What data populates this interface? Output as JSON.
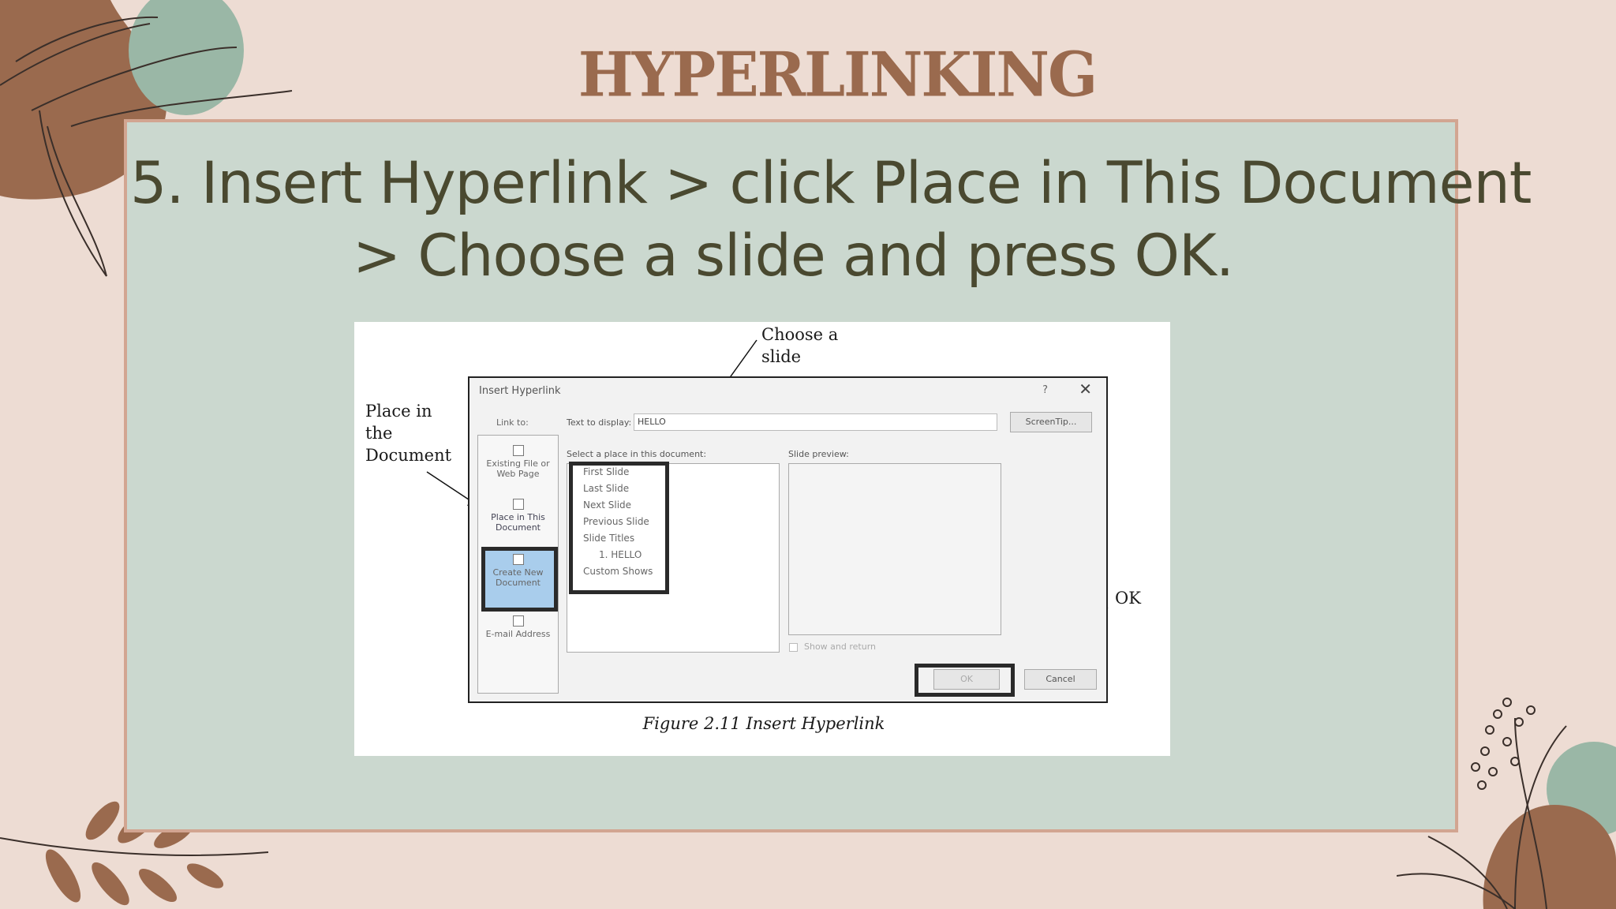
{
  "slide": {
    "title": "HYPERLINKING",
    "instruction_line1": "5. Insert Hyperlink > click Place in This Document",
    "instruction_line2": "> Choose a slide and press OK."
  },
  "figure": {
    "annot_place_line1": "Place in",
    "annot_place_line2": "the",
    "annot_place_line3": "Document",
    "annot_choose_line1": "Choose a",
    "annot_choose_line2": "slide",
    "annot_ok": "OK",
    "caption": "Figure 2.11 Insert Hyperlink"
  },
  "dialog": {
    "title": "Insert Hyperlink",
    "help": "?",
    "close": "✕",
    "link_to_label": "Link to:",
    "link_to_items": [
      {
        "line1": "Existing File or",
        "line2": "Web Page"
      },
      {
        "line1": "Place in This",
        "line2": "Document"
      },
      {
        "line1": "Create New",
        "line2": "Document"
      },
      {
        "line1": "E-mail Address",
        "line2": ""
      }
    ],
    "text_to_display_label": "Text to display:",
    "text_to_display_value": "HELLO",
    "screentip_button": "ScreenTip...",
    "select_place_label": "Select a place in this document:",
    "places": [
      "First Slide",
      "Last Slide",
      "Next Slide",
      "Previous Slide",
      "Slide Titles",
      "1. HELLO",
      "Custom Shows"
    ],
    "slide_preview_label": "Slide preview:",
    "show_and_return": "Show and return",
    "ok_button": "OK",
    "cancel_button": "Cancel"
  }
}
